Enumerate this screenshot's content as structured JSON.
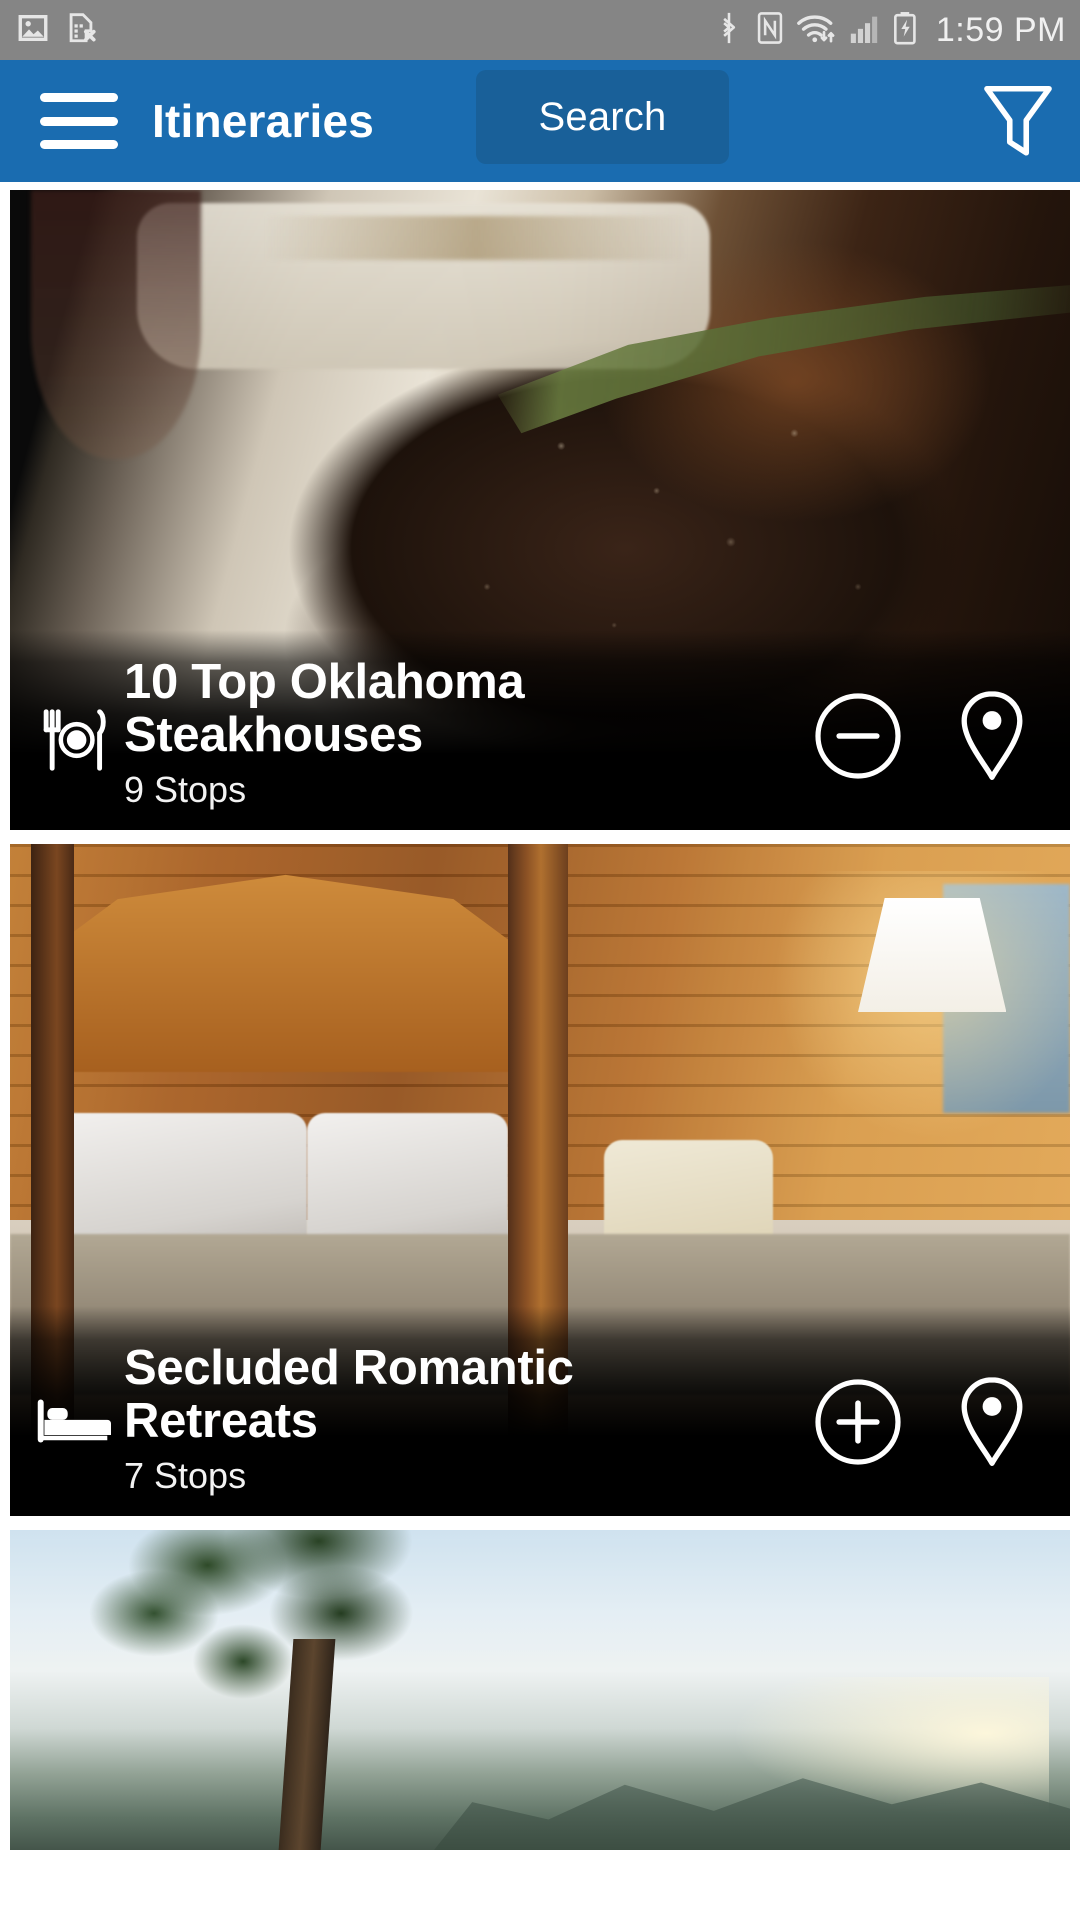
{
  "status_bar": {
    "time": "1:59 PM",
    "left_icons": [
      "image-icon",
      "sim-card-error-icon"
    ],
    "right_icons": [
      "bluetooth-icon",
      "nfc-icon",
      "wifi-icon",
      "signal-icon",
      "battery-charging-icon"
    ],
    "background_color": "#858585"
  },
  "app_bar": {
    "title": "Itineraries",
    "menu_icon": "hamburger-menu-icon",
    "search_label": "Search",
    "filter_icon": "filter-funnel-icon",
    "background_color": "#1a6cb0",
    "search_button_color": "#196099"
  },
  "itineraries": [
    {
      "title": "10 Top Oklahoma Steakhouses",
      "stops": "9 Stops",
      "category_icon": "restaurant-icon",
      "action_icon": "minus-circle-icon",
      "map_icon": "map-pin-icon",
      "image_alt": "grilled steak with rosemary on white plate"
    },
    {
      "title": "Secluded Romantic Retreats",
      "stops": "7 Stops",
      "category_icon": "bed-icon",
      "action_icon": "plus-circle-icon",
      "map_icon": "map-pin-icon",
      "image_alt": "rustic log cabin bedroom with wooden bed and lamp"
    },
    {
      "title": "",
      "stops": "",
      "category_icon": "",
      "action_icon": "",
      "map_icon": "",
      "image_alt": "mountain overlook with tree at sunrise"
    }
  ]
}
